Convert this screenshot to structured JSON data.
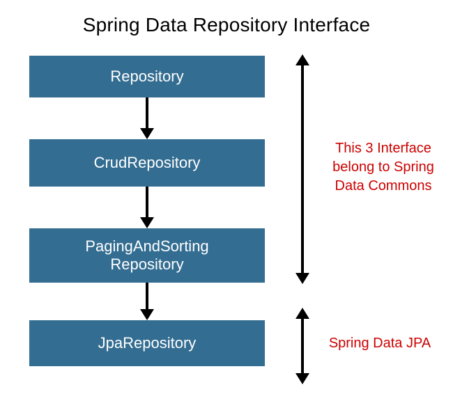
{
  "title": "Spring Data Repository Interface",
  "boxes": {
    "repository": "Repository",
    "crud": "CrudRepository",
    "paging_line1": "PagingAndSorting",
    "paging_line2": "Repository",
    "jpa": "JpaRepository"
  },
  "notes": {
    "commons": "This 3 Interface belong to Spring Data Commons",
    "jpa": "Spring Data JPA"
  }
}
